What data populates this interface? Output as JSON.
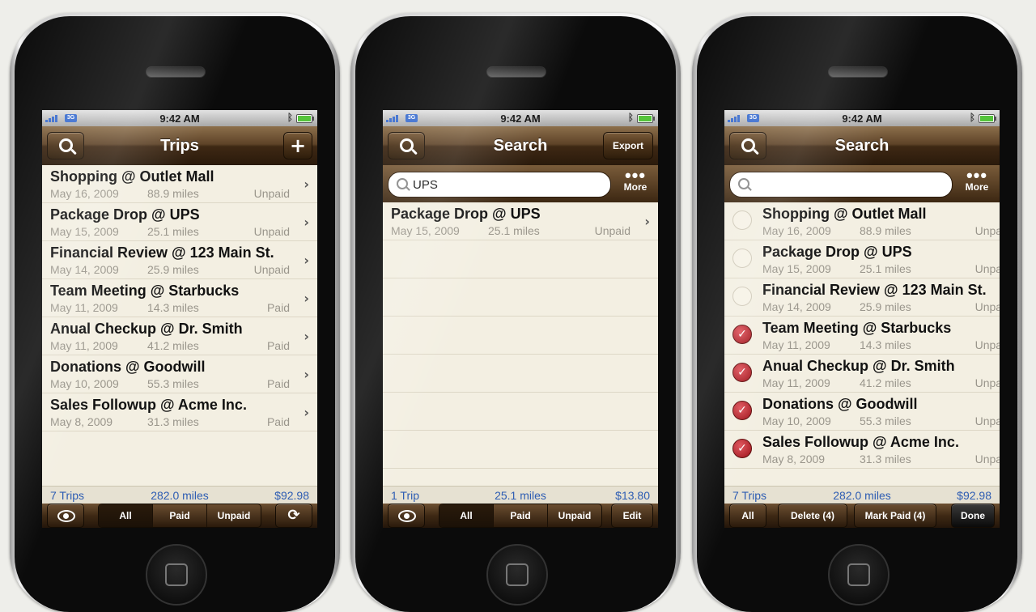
{
  "status": {
    "time": "9:42 AM",
    "network": "3G"
  },
  "phones": [
    {
      "nav": {
        "title": "Trips",
        "right_button": "+"
      },
      "trips": [
        {
          "title": "Shopping @ Outlet Mall",
          "date": "May 16, 2009",
          "miles": "88.9 miles",
          "status": "Unpaid"
        },
        {
          "title": "Package Drop @ UPS",
          "date": "May 15, 2009",
          "miles": "25.1 miles",
          "status": "Unpaid"
        },
        {
          "title": "Financial Review @ 123 Main St.",
          "date": "May 14, 2009",
          "miles": "25.9 miles",
          "status": "Unpaid"
        },
        {
          "title": "Team Meeting @ Starbucks",
          "date": "May 11, 2009",
          "miles": "14.3 miles",
          "status": "Paid"
        },
        {
          "title": "Anual Checkup @ Dr. Smith",
          "date": "May 11, 2009",
          "miles": "41.2 miles",
          "status": "Paid"
        },
        {
          "title": "Donations @ Goodwill",
          "date": "May 10, 2009",
          "miles": "55.3 miles",
          "status": "Paid"
        },
        {
          "title": "Sales Followup @ Acme Inc.",
          "date": "May 8, 2009",
          "miles": "31.3 miles",
          "status": "Paid"
        }
      ],
      "summary": {
        "count": "7 Trips",
        "miles": "282.0 miles",
        "total": "$92.98"
      },
      "toolbar": {
        "seg_all": "All",
        "seg_paid": "Paid",
        "seg_unpaid": "Unpaid",
        "selected": "All"
      }
    },
    {
      "nav": {
        "title": "Search",
        "right_button": "Export"
      },
      "search": {
        "value": "UPS",
        "more_label": "More"
      },
      "trips": [
        {
          "title": "Package Drop @ UPS",
          "date": "May 15, 2009",
          "miles": "25.1 miles",
          "status": "Unpaid"
        }
      ],
      "summary": {
        "count": "1 Trip",
        "miles": "25.1 miles",
        "total": "$13.80"
      },
      "toolbar": {
        "seg_all": "All",
        "seg_paid": "Paid",
        "seg_unpaid": "Unpaid",
        "edit": "Edit",
        "selected": "All"
      }
    },
    {
      "nav": {
        "title": "Search"
      },
      "search": {
        "value": "",
        "more_label": "More"
      },
      "trips": [
        {
          "title": "Shopping @ Outlet Mall",
          "date": "May 16, 2009",
          "miles": "88.9 miles",
          "status": "Unpaid",
          "checked": false
        },
        {
          "title": "Package Drop @ UPS",
          "date": "May 15, 2009",
          "miles": "25.1 miles",
          "status": "Unpaid",
          "checked": false
        },
        {
          "title": "Financial Review @ 123 Main St.",
          "date": "May 14, 2009",
          "miles": "25.9 miles",
          "status": "Unpaid",
          "checked": false
        },
        {
          "title": "Team Meeting @ Starbucks",
          "date": "May 11, 2009",
          "miles": "14.3 miles",
          "status": "Unpaid",
          "checked": true
        },
        {
          "title": "Anual Checkup @ Dr. Smith",
          "date": "May 11, 2009",
          "miles": "41.2 miles",
          "status": "Unpaid",
          "checked": true
        },
        {
          "title": "Donations @ Goodwill",
          "date": "May 10, 2009",
          "miles": "55.3 miles",
          "status": "Unpaid",
          "checked": true
        },
        {
          "title": "Sales Followup @ Acme Inc.",
          "date": "May 8, 2009",
          "miles": "31.3 miles",
          "status": "Unpaid",
          "checked": true
        }
      ],
      "summary": {
        "count": "7 Trips",
        "miles": "282.0 miles",
        "total": "$92.98"
      },
      "toolbar": {
        "all": "All",
        "delete": "Delete (4)",
        "mark_paid": "Mark Paid (4)",
        "done": "Done"
      }
    }
  ],
  "colors": {
    "nav_brown": "#4a3219",
    "paper": "#f3efe2",
    "summary_blue": "#2e5db3",
    "check_red": "#b3141c"
  },
  "icons": {
    "search": "search-icon",
    "eye": "eye-icon",
    "refresh": "refresh-icon",
    "chevron": "chevron-right-icon",
    "bluetooth": "bluetooth-icon",
    "battery": "battery-icon",
    "signal": "signal-icon"
  }
}
